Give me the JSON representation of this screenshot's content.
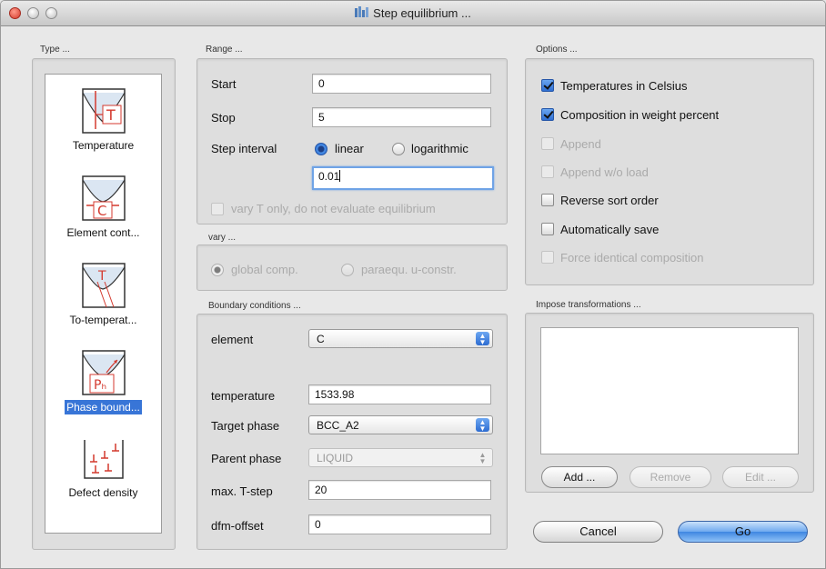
{
  "window": {
    "title": "Step equilibrium ..."
  },
  "groups": {
    "type": "Type ...",
    "range": "Range ...",
    "vary": "vary ...",
    "boundary": "Boundary conditions ...",
    "options": "Options ...",
    "impose": "Impose transformations ..."
  },
  "type_items": [
    {
      "label": "Temperature",
      "selected": false,
      "icon": "temperature-diagram-icon"
    },
    {
      "label": "Element cont...",
      "selected": false,
      "icon": "element-content-diagram-icon"
    },
    {
      "label": "To-temperat...",
      "selected": false,
      "icon": "to-temperature-diagram-icon"
    },
    {
      "label": "Phase bound...",
      "selected": true,
      "icon": "phase-boundary-diagram-icon"
    },
    {
      "label": "Defect density",
      "selected": false,
      "icon": "defect-density-icon"
    }
  ],
  "range": {
    "start_label": "Start",
    "start_value": "0",
    "stop_label": "Stop",
    "stop_value": "5",
    "step_label": "Step interval",
    "linear_label": "linear",
    "log_label": "logarithmic",
    "step_value": "0.01",
    "vary_t_label": "vary T only, do not evaluate equilibrium"
  },
  "vary": {
    "global_label": "global comp.",
    "paraequ_label": "paraequ. u-constr."
  },
  "boundary": {
    "element_label": "element",
    "element_value": "C",
    "temperature_label": "temperature",
    "temperature_value": "1533.98",
    "target_label": "Target phase",
    "target_value": "BCC_A2",
    "parent_label": "Parent phase",
    "parent_value": "LIQUID",
    "tstep_label": "max. T-step",
    "tstep_value": "20",
    "dfm_label": "dfm-offset",
    "dfm_value": "0"
  },
  "options": [
    {
      "label": "Temperatures in Celsius",
      "checked": true,
      "enabled": true
    },
    {
      "label": "Composition in weight percent",
      "checked": true,
      "enabled": true
    },
    {
      "label": "Append",
      "checked": false,
      "enabled": false
    },
    {
      "label": "Append w/o load",
      "checked": false,
      "enabled": false
    },
    {
      "label": "Reverse sort order",
      "checked": false,
      "enabled": true
    },
    {
      "label": "Automatically save",
      "checked": false,
      "enabled": true
    },
    {
      "label": "Force identical composition",
      "checked": false,
      "enabled": false
    }
  ],
  "impose": {
    "add": "Add ...",
    "remove": "Remove",
    "edit": "Edit ..."
  },
  "footer": {
    "cancel": "Cancel",
    "go": "Go"
  },
  "colors": {
    "selection": "#3875d7",
    "diagram_red": "#d43a2f",
    "accent": "#2f6fd3"
  }
}
